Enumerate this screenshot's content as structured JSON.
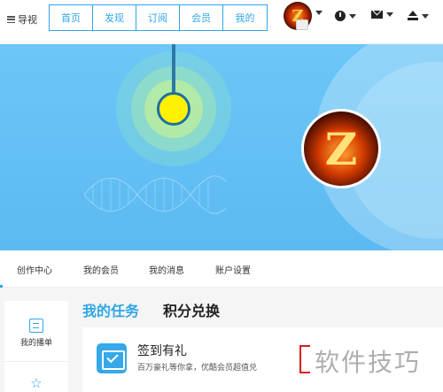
{
  "header": {
    "guide_label": "导视",
    "nav_tabs": [
      "首页",
      "发现",
      "订阅",
      "会员",
      "我的"
    ],
    "avatar_letter": "Z"
  },
  "banner": {
    "avatar_letter": "Z"
  },
  "subnav": {
    "items": [
      "创作中心",
      "我的会员",
      "我的消息",
      "账户设置"
    ]
  },
  "sidebar": {
    "items": [
      "我的播单"
    ]
  },
  "tasks": {
    "tabs": [
      "我的任务",
      "积分兑换"
    ],
    "card": {
      "title": "签到有礼",
      "description": "百万豪礼等你拿，优酷会员超值兑"
    }
  },
  "watermark": "软件技巧",
  "colors": {
    "accent": "#2fa6e8",
    "banner": "#6cc6f7",
    "highlight_dot": "#fff200",
    "annotation_red": "#d42020"
  }
}
